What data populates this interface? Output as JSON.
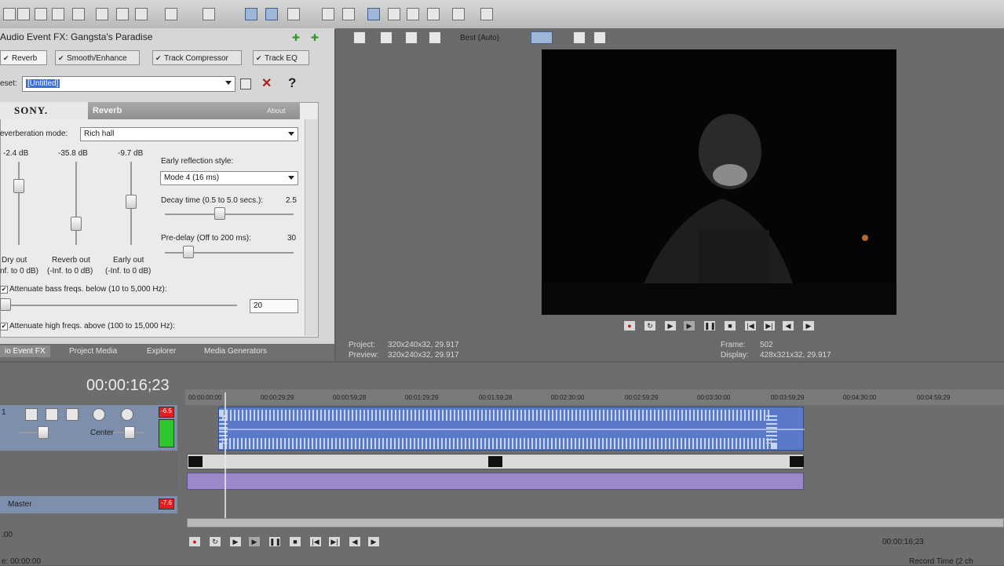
{
  "fx_panel": {
    "title": "Audio Event FX: Gangsta's Paradise",
    "chain": [
      "Reverb",
      "Smooth/Enhance",
      "Track Compressor",
      "Track EQ"
    ],
    "preset_label": "eset:",
    "preset_value": "[Untitled]",
    "plugin": {
      "brand": "SONY.",
      "name": "Reverb",
      "about": "About",
      "reverb_mode_label": "everberation mode:",
      "reverb_mode_value": "Rich hall",
      "sliders": [
        {
          "db": "-2.4 dB",
          "name": "Dry out",
          "range": "nf. to 0 dB)",
          "level": 0.25
        },
        {
          "db": "-35.8 dB",
          "name": "Reverb out",
          "range": "(-Inf. to 0 dB)",
          "level": 0.8
        },
        {
          "db": "-9.7 dB",
          "name": "Early out",
          "range": "(-Inf. to 0 dB)",
          "level": 0.48
        }
      ],
      "early_reflection_label": "Early reflection style:",
      "early_reflection_value": "Mode 4 (16 ms)",
      "decay_label": "Decay time (0.5 to 5.0 secs.):",
      "decay_value": "2.5",
      "decay_level": 0.42,
      "predelay_label": "Pre-delay (Off to 200 ms):",
      "predelay_value": "30",
      "predelay_level": 0.15,
      "bass_label": "Attenuate bass freqs. below (10 to 5,000 Hz):",
      "bass_value": "20",
      "high_label": "Attenuate high freqs. above (100 to 15,000 Hz):"
    }
  },
  "dock_tabs": [
    "io Event FX",
    "Project Media",
    "Explorer",
    "Media Generators"
  ],
  "preview": {
    "quality": "Best (Auto)",
    "project_label": "Project:",
    "project_value": "320x240x32, 29.917",
    "preview_label": "Preview:",
    "preview_value": "320x240x32, 29.917",
    "frame_label": "Frame:",
    "frame_value": "502",
    "display_label": "Display:",
    "display_value": "428x321x32, 29.917"
  },
  "timeline": {
    "time": "00:00:16;23",
    "ruler": [
      "00:00:00;00",
      "00:00:29;29",
      "00:00:59;28",
      "00:01:29;29",
      "00:01:59;28",
      "00:02:30:00",
      "00:02:59;29",
      "00:03:30:00",
      "00:03:59;29",
      "00:04:30:00",
      "00:04:59;29"
    ],
    "track1_num": "1",
    "track1_pan": "Center",
    "track1_ch": "-6.5",
    "master_label": "Master",
    "master_badge": "-7.6",
    "bottom_left": ".00",
    "bottom_left2": "e: 00:00:00",
    "record_time": "00:00:16;23",
    "record_label": "Record Time (2 ch"
  },
  "colors": {
    "accent": "#3b6fd6",
    "audio_clip": "#5a7ac8",
    "video_track": "#d9d9d9",
    "record_red": "#c81818"
  }
}
